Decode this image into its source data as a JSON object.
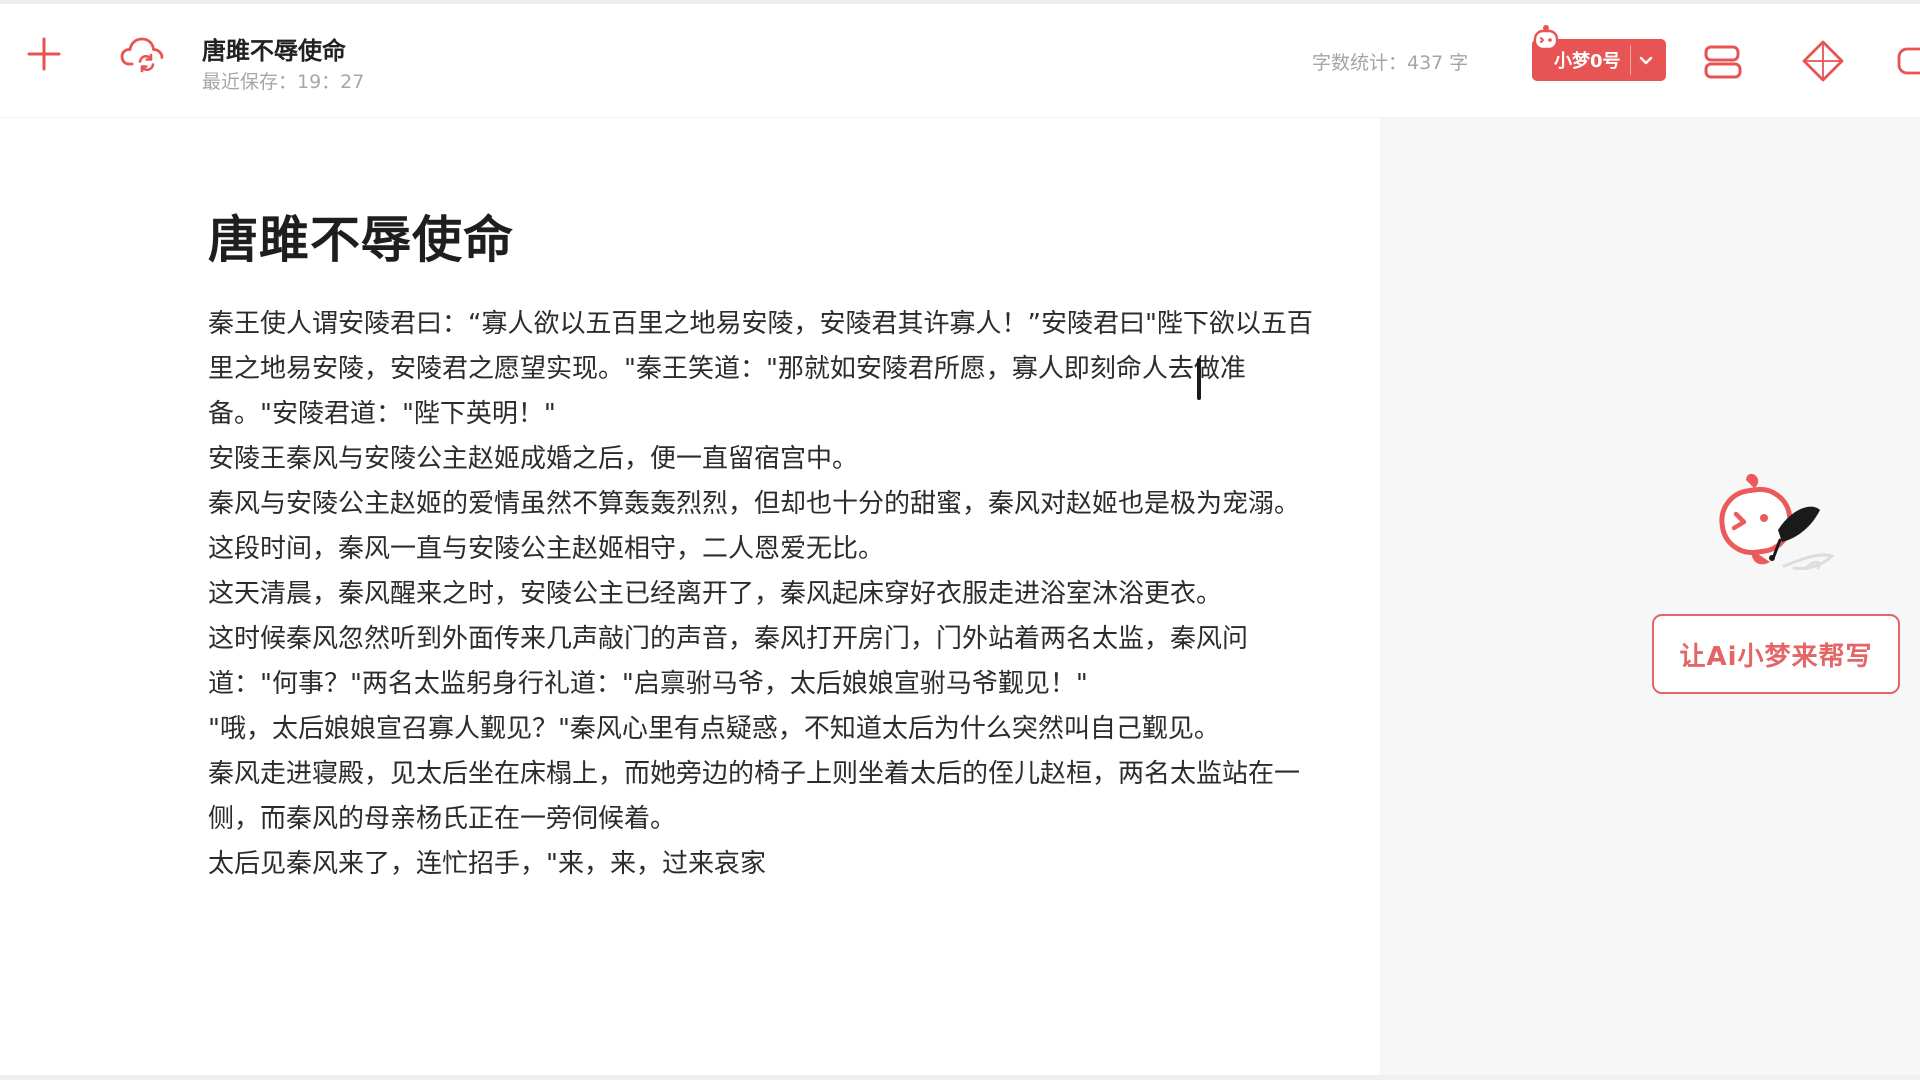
{
  "header": {
    "doc_title": "唐雎不辱使命",
    "last_saved": "最近保存：19：27",
    "word_count": "字数统计：437 字",
    "model_label": "小梦0号"
  },
  "article": {
    "title": "唐雎不辱使命",
    "paragraphs": [
      "秦王使人谓安陵君曰：“寡人欲以五百里之地易安陵，安陵君其许寡人！”安陵君曰\"陛下欲以五百里之地易安陵，安陵君之愿望实现。\"秦王笑道：\"那就如安陵君所愿，寡人即刻命人去做准备。\"安陵君道：\"陛下英明！\"",
      "安陵王秦风与安陵公主赵姬成婚之后，便一直留宿宫中。",
      "秦风与安陵公主赵姬的爱情虽然不算轰轰烈烈，但却也十分的甜蜜，秦风对赵姬也是极为宠溺。",
      "这段时间，秦风一直与安陵公主赵姬相守，二人恩爱无比。",
      "这天清晨，秦风醒来之时，安陵公主已经离开了，秦风起床穿好衣服走进浴室沐浴更衣。",
      "这时候秦风忽然听到外面传来几声敲门的声音，秦风打开房门，门外站着两名太监，秦风问道：\"何事？\"两名太监躬身行礼道：\"启禀驸马爷，太后娘娘宣驸马爷觐见！\"",
      "\"哦，太后娘娘宣召寡人觐见？\"秦风心里有点疑惑，不知道太后为什么突然叫自己觐见。",
      "秦风走进寝殿，见太后坐在床榻上，而她旁边的椅子上则坐着太后的侄儿赵桓，两名太监站在一侧，而秦风的母亲杨氏正在一旁伺候着。",
      "太后见秦风来了，连忙招手，\"来，来，过来哀家"
    ]
  },
  "side_panel": {
    "ai_button_label": "让Ai小梦来帮写"
  },
  "icons": {
    "new": "plus-icon",
    "cloud_sync": "cloud-sync-icon",
    "outline": "outline-icon",
    "inspiration": "diamond-icon",
    "mascot": "mascot-icon"
  },
  "colors": {
    "accent": "#e85353",
    "accent_light": "#e46565",
    "side_bg": "#f7f7f7"
  }
}
